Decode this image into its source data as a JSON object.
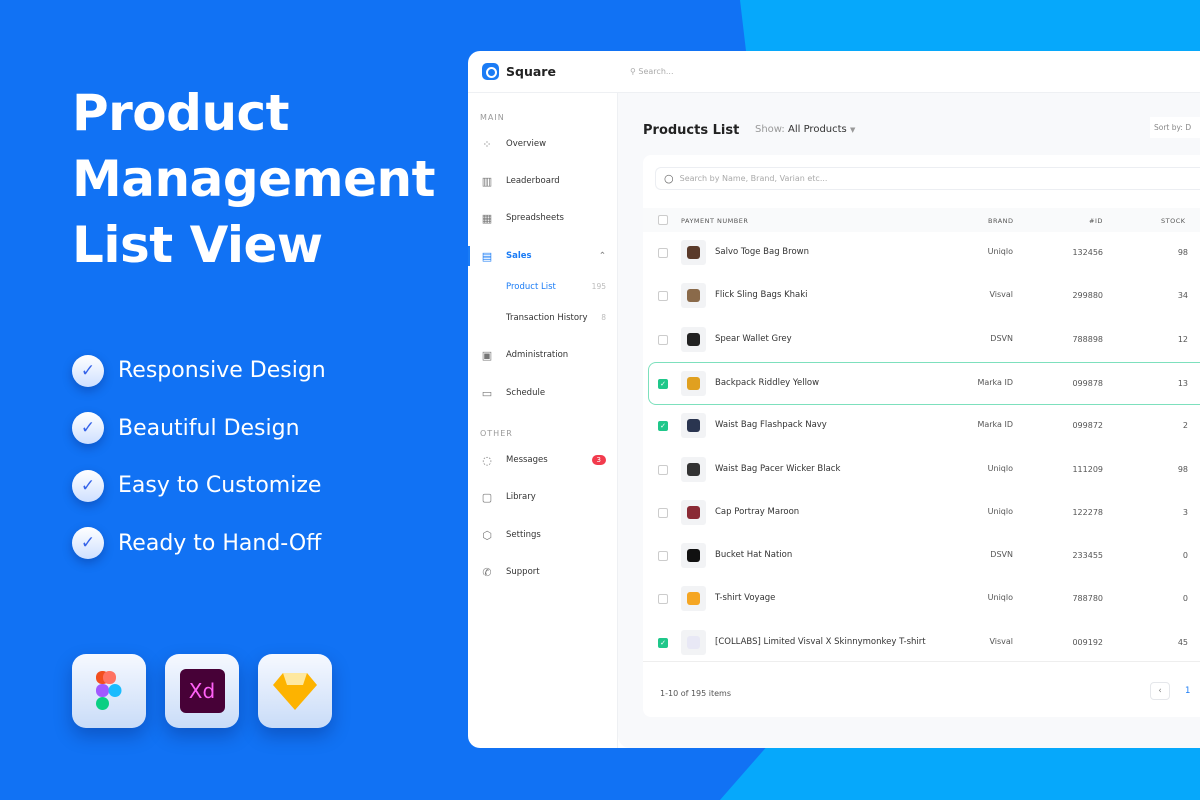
{
  "hero": {
    "line1": "Product",
    "line2": "Management",
    "line3": "List View"
  },
  "features": [
    "Responsive Design",
    "Beautiful Design",
    "Easy to Customize",
    "Ready to Hand-Off"
  ],
  "tools": [
    {
      "icon": "figma-icon"
    },
    {
      "icon": "adobe-xd-icon",
      "label": "Xd"
    },
    {
      "icon": "sketch-icon"
    }
  ],
  "app": {
    "name": "Square",
    "search_placeholder": "Search..."
  },
  "sidebar": {
    "main_label": "MAIN",
    "other_label": "OTHER",
    "items": [
      {
        "label": "Overview"
      },
      {
        "label": "Leaderboard"
      },
      {
        "label": "Spreadsheets"
      },
      {
        "label": "Sales"
      },
      {
        "label": "Administration"
      },
      {
        "label": "Schedule"
      },
      {
        "label": "Messages",
        "badge": "3"
      },
      {
        "label": "Library"
      },
      {
        "label": "Settings"
      },
      {
        "label": "Support"
      }
    ],
    "sub": [
      {
        "label": "Product List",
        "count": "195"
      },
      {
        "label": "Transaction History",
        "count": "8"
      }
    ]
  },
  "page": {
    "title": "Products List",
    "show_label": "Show:",
    "show_value": "All Products",
    "sort_label": "Sort by: D"
  },
  "table": {
    "search_placeholder": "Search by Name, Brand, Varian etc...",
    "columns": [
      "PAYMENT NUMBER",
      "BRAND",
      "#ID",
      "STOCK"
    ],
    "rows": [
      {
        "name": "Salvo Toge Bag Brown",
        "brand": "Uniqlo",
        "id": "132456",
        "stock": "98",
        "checked": false
      },
      {
        "name": "Flick Sling Bags Khaki",
        "brand": "Visval",
        "id": "299880",
        "stock": "34",
        "checked": false
      },
      {
        "name": "Spear Wallet Grey",
        "brand": "DSVN",
        "id": "788898",
        "stock": "12",
        "checked": false
      },
      {
        "name": "Backpack Riddley Yellow",
        "brand": "Marka ID",
        "id": "099878",
        "stock": "13",
        "checked": true
      },
      {
        "name": "Waist Bag Flashpack Navy",
        "brand": "Marka ID",
        "id": "099872",
        "stock": "2",
        "checked": true
      },
      {
        "name": "Waist Bag Pacer Wicker Black",
        "brand": "Uniqlo",
        "id": "111209",
        "stock": "98",
        "checked": false
      },
      {
        "name": "Cap Portray Maroon",
        "brand": "Uniqlo",
        "id": "122278",
        "stock": "3",
        "checked": false
      },
      {
        "name": "Bucket Hat Nation",
        "brand": "DSVN",
        "id": "233455",
        "stock": "0",
        "checked": false
      },
      {
        "name": "T-shirt Voyage",
        "brand": "Uniqlo",
        "id": "788780",
        "stock": "0",
        "checked": false
      },
      {
        "name": "[COLLABS] Limited Visval X Skinnymonkey T-shirt",
        "brand": "Visval",
        "id": "009192",
        "stock": "45",
        "checked": true
      }
    ],
    "thumb_colors": [
      "#5a3a2a",
      "#8a6a4a",
      "#222",
      "#e0a020",
      "#2a3550",
      "#333",
      "#8a2a35",
      "#111",
      "#f5a623",
      "#e8e8f5"
    ],
    "summary": "1-10 of 195 items",
    "page": "1"
  },
  "colors": {
    "accent": "#1b7cf5",
    "check": "#1fc78a",
    "badge": "#f23b4d"
  }
}
